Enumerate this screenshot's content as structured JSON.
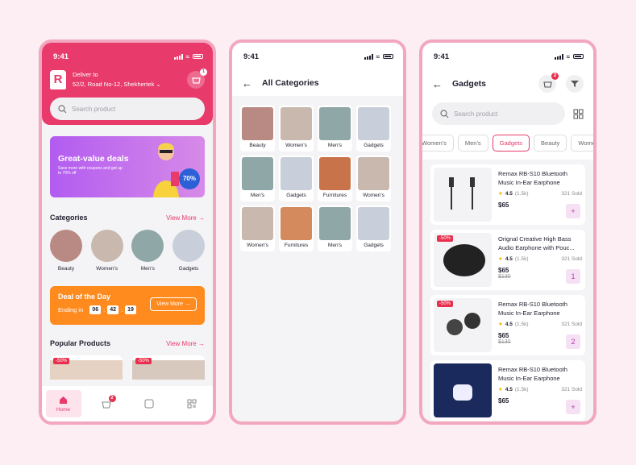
{
  "colors": {
    "accent": "#e83a6b",
    "deal": "#ff8a1e",
    "background": "#fdeef3"
  },
  "status": {
    "time": "9:41"
  },
  "home": {
    "deliver_label": "Deliver to",
    "address": "52/2, Road No-12, Shekhertek",
    "cart_count": "1",
    "search_placeholder": "Search product",
    "banner": {
      "title": "Great-value deals",
      "subtitle": "Save more with coupons and get up to 70% off",
      "sale": "70%"
    },
    "categories_title": "Categories",
    "view_more": "View More",
    "categories": [
      "Beauty",
      "Women's",
      "Men's",
      "Gadgets"
    ],
    "deal": {
      "title": "Deal of the Day",
      "ending": "Ending in",
      "hours": "06",
      "minutes": "42",
      "seconds": "19",
      "button": "View More"
    },
    "popular_title": "Popular Products",
    "popular_discounts": [
      "-50%",
      "-50%"
    ],
    "nav": {
      "home": "Home",
      "cart_badge": "2"
    }
  },
  "categories_page": {
    "title": "All Categories",
    "tiles": [
      "Beauty",
      "Women's",
      "Men's",
      "Gadgets",
      "Men's",
      "Gadgets",
      "Furnitures",
      "Women's",
      "Women's",
      "Furnitures",
      "Men's",
      "Gadgets"
    ]
  },
  "gadgets": {
    "title": "Gadgets",
    "cart_count": "2",
    "search_placeholder": "Search product",
    "chips": [
      "Women's",
      "Men's",
      "Gadgets",
      "Beauty",
      "Wome"
    ],
    "products": [
      {
        "title": "Remax RB-S10 Bluetooth Music In-Ear Earphone",
        "rating": "4.5",
        "reviews": "(1.5k)",
        "sold": "321 Sold",
        "price": "$65",
        "old": "",
        "discount": "",
        "qty": "+"
      },
      {
        "title": "Orignal Creative High Bass Audio Earphone with Pouc...",
        "rating": "4.5",
        "reviews": "(1.5k)",
        "sold": "321 Sold",
        "price": "$65",
        "old": "$130",
        "discount": "-50%",
        "qty": "1"
      },
      {
        "title": "Remax RB-S10 Bluetooth Music In-Ear Earphone",
        "rating": "4.5",
        "reviews": "(1.5k)",
        "sold": "321 Sold",
        "price": "$65",
        "old": "$130",
        "discount": "-50%",
        "qty": "2"
      },
      {
        "title": "Remax RB-S10 Bluetooth Music In-Ear Earphone",
        "rating": "4.5",
        "reviews": "(1.5k)",
        "sold": "321 Sold",
        "price": "$65",
        "old": "",
        "discount": "",
        "qty": "+"
      }
    ]
  }
}
